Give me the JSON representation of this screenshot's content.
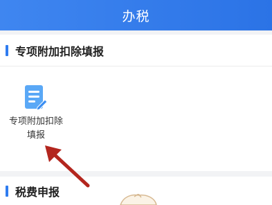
{
  "header": {
    "title": "办税"
  },
  "special_section": {
    "title": "专项附加扣除填报",
    "tile": {
      "label_line1": "专项附加扣除",
      "label_line2": "填报",
      "icon": "document-edit-icon"
    }
  },
  "tax_section": {
    "title": "税费申报"
  },
  "colors": {
    "header_blue": "#2f7cf0",
    "accent_bar": "#2f7cf0",
    "arrow": "#b3261e"
  }
}
